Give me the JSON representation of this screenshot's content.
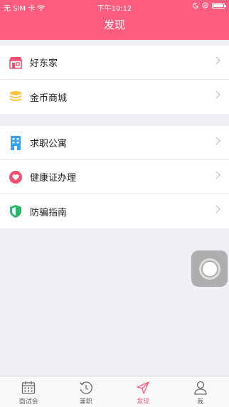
{
  "status_bar": {
    "carrier": "无 SIM 卡",
    "time": "下午10:12"
  },
  "header": {
    "title": "发现"
  },
  "sections": [
    {
      "items": [
        {
          "label": "好东家",
          "icon": "store-icon",
          "icon_color": "#f0506e"
        },
        {
          "label": "金币商城",
          "icon": "coin-stack-icon",
          "icon_color": "#f7c343"
        }
      ]
    },
    {
      "items": [
        {
          "label": "求职公寓",
          "icon": "building-icon",
          "icon_color": "#3aa0e8"
        },
        {
          "label": "健康证办理",
          "icon": "heart-icon",
          "icon_color": "#f0506e"
        },
        {
          "label": "防骗指南",
          "icon": "shield-icon",
          "icon_color": "#2fb36b"
        }
      ]
    }
  ],
  "tab_bar": {
    "tabs": [
      {
        "label": "面试会",
        "icon": "calendar-icon",
        "active": false
      },
      {
        "label": "兼职",
        "icon": "clock-refresh-icon",
        "active": false
      },
      {
        "label": "发现",
        "icon": "navigation-arrow-icon",
        "active": true
      },
      {
        "label": "我",
        "icon": "person-icon",
        "active": false
      }
    ],
    "active_color": "#fe5d7f",
    "inactive_color": "#666666"
  },
  "theme": {
    "brand_color": "#fe5d7f",
    "background": "#efeff4"
  }
}
